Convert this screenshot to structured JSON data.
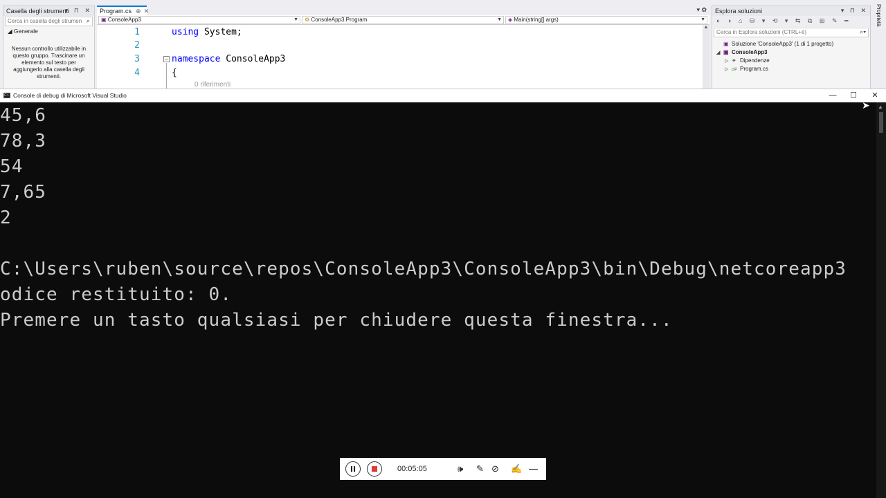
{
  "toolbox": {
    "title": "Casella degli strumenti",
    "controls": "▾ ⊓ ✕",
    "search_placeholder": "Cerca in casella degli strumen",
    "group": "◢ Generale",
    "empty_message": "Nessun controllo utilizzabile in questo gruppo. Trascinare un elemento sul testo per aggiungerlo alla casella degli strumenti."
  },
  "editor": {
    "tab": {
      "name": "Program.cs",
      "pin": "⊕",
      "close": "✕"
    },
    "tabrow_controls": "▾ ✿",
    "nav": {
      "project": "ConsoleApp3",
      "class": "ConsoleApp3.Program",
      "member": "Main(string[] args)"
    },
    "lines": [
      {
        "num": "1",
        "kw": "using",
        "rest": " System;"
      },
      {
        "num": "2",
        "kw": "",
        "rest": ""
      },
      {
        "num": "3",
        "kw": "namespace",
        "rest": " ConsoleApp3"
      },
      {
        "num": "4",
        "kw": "",
        "rest": "{"
      }
    ],
    "collapse_glyph": "−",
    "references": "0 riferimenti"
  },
  "solution_explorer": {
    "title": "Esplora soluzioni",
    "controls": "▾ ⊓ ✕",
    "search_placeholder": "Cerca in Esplora soluzioni (CTRL+è)",
    "toolbar_glyphs": "◐ ◑ ⌂ ⛁ ▾ ⟲ ▾ ⇆ ⧉ ⊞ ✎ ━",
    "items": [
      {
        "arrow": "",
        "icon": "▣",
        "label": "Soluzione 'ConsoleApp3' (1 di 1 progetto)",
        "bold": false,
        "indent": 6
      },
      {
        "arrow": "◢",
        "icon": "▣",
        "label": "ConsoleApp3",
        "bold": true,
        "indent": 6
      },
      {
        "arrow": "▷",
        "icon": "⚭",
        "label": "Dipendenze",
        "bold": false,
        "indent": 18
      },
      {
        "arrow": "▷",
        "icon": "c#",
        "label": "Program.cs",
        "bold": false,
        "indent": 18
      }
    ]
  },
  "properties_strip": {
    "label": "Proprietà"
  },
  "console": {
    "title": "Console di debug di Microsoft Visual Studio",
    "icon_label": "C:\\",
    "buttons": {
      "minimize": "—",
      "maximize": "☐",
      "close": "✕"
    },
    "output": [
      "45,6",
      "78,3",
      "54",
      "7,65",
      "2",
      "",
      "C:\\Users\\ruben\\source\\repos\\ConsoleApp3\\ConsoleApp3\\bin\\Debug\\netcoreapp3",
      "odice restituito: 0.",
      "Premere un tasto qualsiasi per chiudere questa finestra..."
    ]
  },
  "recorder": {
    "time": "00:05:05",
    "icons": {
      "volume": "🕪",
      "mic": "✎",
      "camera": "⊘",
      "draw": "✍",
      "minimize": "—"
    }
  }
}
